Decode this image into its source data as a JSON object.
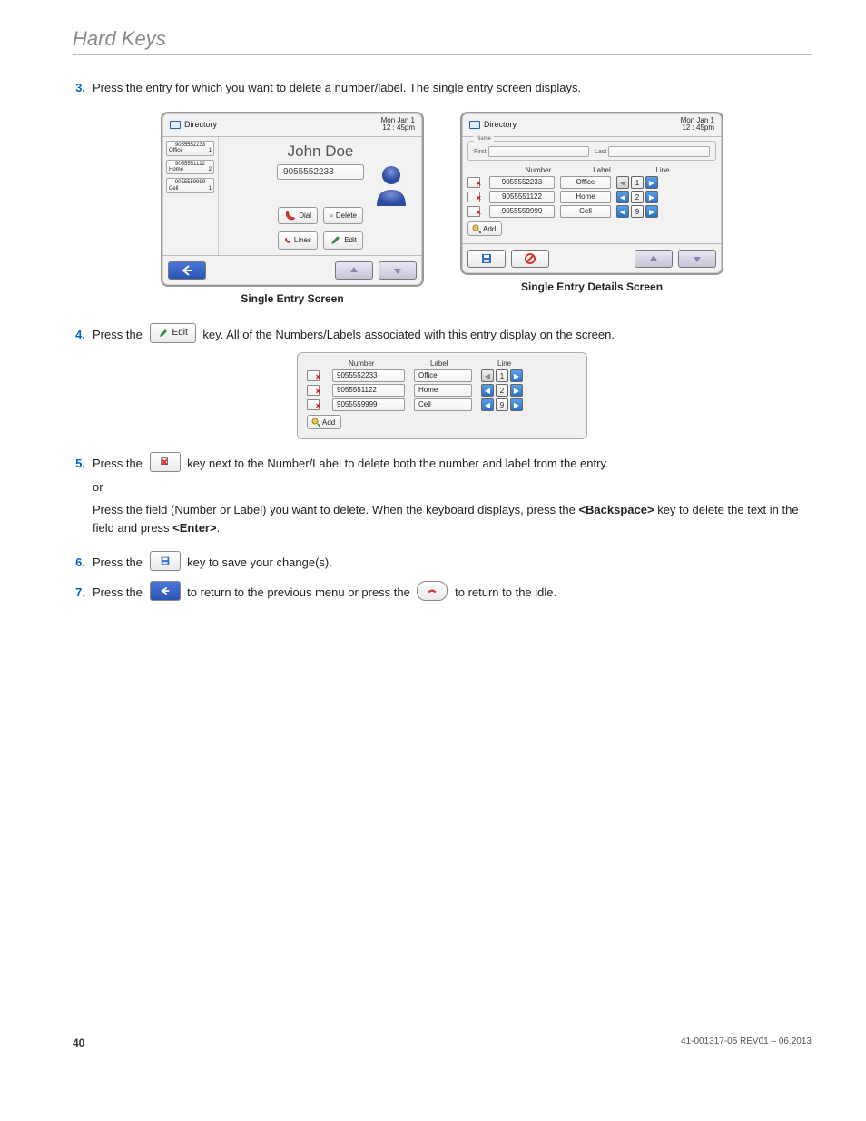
{
  "page_title": "Hard Keys",
  "page_number": "40",
  "doc_ref": "41-001317-05 REV01 – 06.2013",
  "steps": {
    "s3": {
      "num": "3.",
      "text": "Press the entry for which you want to delete a number/label. The single entry screen displays."
    },
    "s4": {
      "num": "4.",
      "pre": "Press the",
      "post": " key. All of the Numbers/Labels associated with this entry display on the screen."
    },
    "s5": {
      "num": "5.",
      "line1_pre": "Press the",
      "line1_post": " key next to the Number/Label to delete both the number and label from the entry.",
      "or": "or",
      "line2a": "Press the field (Number or Label) you want to delete. When the keyboard displays, press the ",
      "line2_key1": "<Backspace>",
      "line2b": " key to delete the text in the field and press ",
      "line2_key2": "<Enter>",
      "line2c": "."
    },
    "s6": {
      "num": "6.",
      "pre": "Press the",
      "post": " key to save your change(s)."
    },
    "s7": {
      "num": "7.",
      "pre": "Press the",
      "mid": " to return to the previous menu or press the ",
      "post": " to return to the idle."
    }
  },
  "captions": {
    "left": "Single Entry Screen",
    "right": "Single Entry Details Screen"
  },
  "screen_common": {
    "header_title": "Directory",
    "date": "Mon Jan 1",
    "time": "12 : 45pm"
  },
  "single_entry": {
    "name": "John Doe",
    "number": "9055552233",
    "side": [
      {
        "num": "9055552233",
        "label": "Office",
        "line": "1"
      },
      {
        "num": "9055551122",
        "label": "Home",
        "line": "2"
      },
      {
        "num": "9055559999",
        "label": "Cell",
        "line": "1"
      }
    ],
    "btn_dial": "Dial",
    "btn_delete": "Delete",
    "btn_lines": "Lines",
    "btn_edit": "Edit"
  },
  "details": {
    "name_legend": "Name",
    "first_label": "First",
    "last_label": "Last",
    "hdr_number": "Number",
    "hdr_label": "Label",
    "hdr_line": "Line",
    "rows": [
      {
        "num": "9055552233",
        "label": "Office",
        "line": "1",
        "left_enabled": false
      },
      {
        "num": "9055551122",
        "label": "Home",
        "line": "2",
        "left_enabled": true
      },
      {
        "num": "9055559999",
        "label": "Cell",
        "line": "9",
        "left_enabled": true
      }
    ],
    "btn_add": "Add"
  },
  "edit_key_label": "Edit"
}
